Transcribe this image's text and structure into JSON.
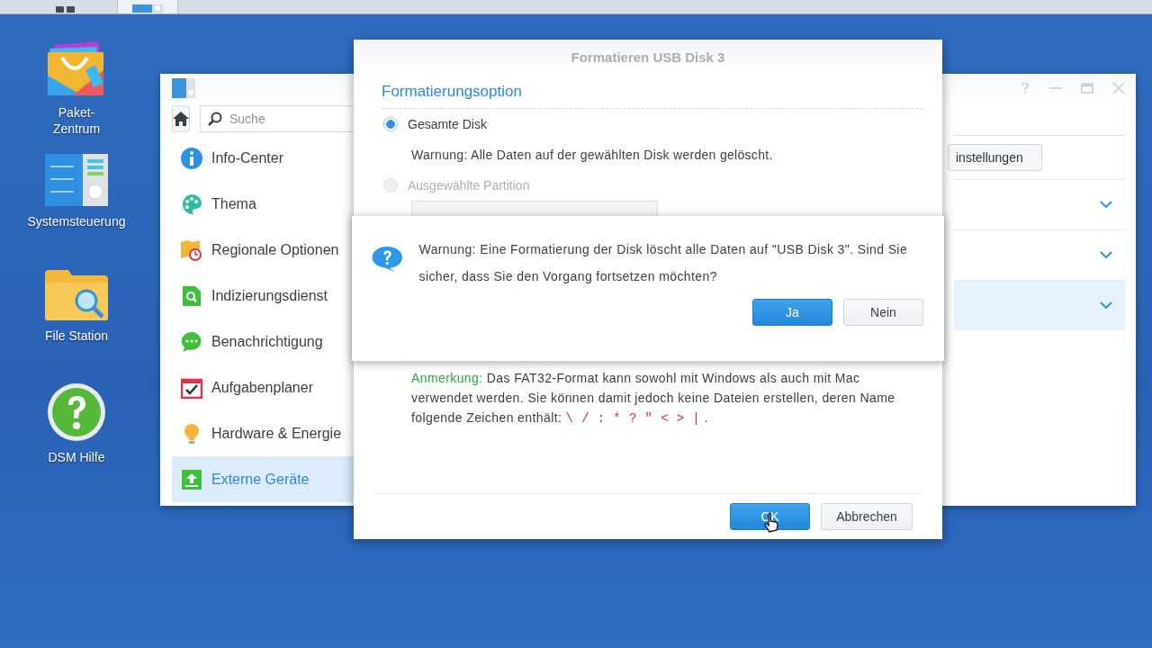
{
  "taskbar": {
    "buttons": [
      {
        "kind": "apps",
        "selected": false
      },
      {
        "kind": "control",
        "selected": true
      }
    ]
  },
  "desktop_icons": [
    {
      "kind": "package",
      "label": "Paket-\nZentrum"
    },
    {
      "kind": "control",
      "label": "Systemsteuerung"
    },
    {
      "kind": "folder",
      "label": "File Station"
    },
    {
      "kind": "help",
      "label": "DSM Hilfe"
    }
  ],
  "control_panel": {
    "search": {
      "placeholder": "Suche"
    },
    "sidebar": {
      "items": [
        {
          "label": "Info-Center",
          "selected": false
        },
        {
          "label": "Thema",
          "selected": false
        },
        {
          "label": "Regionale Optionen",
          "selected": false
        },
        {
          "label": "Indizierungsdienst",
          "selected": false
        },
        {
          "label": "Benachrichtigung",
          "selected": false
        },
        {
          "label": "Aufgabenplaner",
          "selected": false
        },
        {
          "label": "Hardware & Energie",
          "selected": false
        },
        {
          "label": "Externe Geräte",
          "selected": true
        }
      ]
    },
    "settings_button": "instellungen",
    "rows": [
      {
        "selected": false
      },
      {
        "selected": false
      },
      {
        "selected": true
      }
    ]
  },
  "format_dialog": {
    "title": "Formatieren USB Disk 3",
    "section": "Formatierungsoption",
    "options": [
      {
        "label": "Gesamte Disk",
        "selected": true,
        "disabled": false,
        "hint": "Warnung: Alle Daten auf der gewählten Disk werden gelöscht."
      },
      {
        "label": "Ausgewählte Partition",
        "selected": false,
        "disabled": true
      }
    ],
    "note": {
      "label": "Anmerkung:",
      "text": "Das FAT32-Format kann sowohl mit Windows als auch mit Mac verwendet werden. Sie können damit jedoch keine Dateien erstellen, deren Name folgende Zeichen enthält:",
      "chars": "\\ / : * ? \" < > |",
      "end": "."
    },
    "buttons": [
      {
        "label": "OK",
        "primary": true
      },
      {
        "label": "Abbrechen",
        "primary": false
      }
    ]
  },
  "confirm_dialog": {
    "message": "Warnung: Eine Formatierung der Disk löscht alle Daten auf \"USB Disk 3\". Sind Sie sicher, dass Sie den Vorgang fortsetzen möchten?",
    "buttons": [
      {
        "label": "Ja",
        "primary": true
      },
      {
        "label": "Nein",
        "primary": false
      }
    ]
  }
}
